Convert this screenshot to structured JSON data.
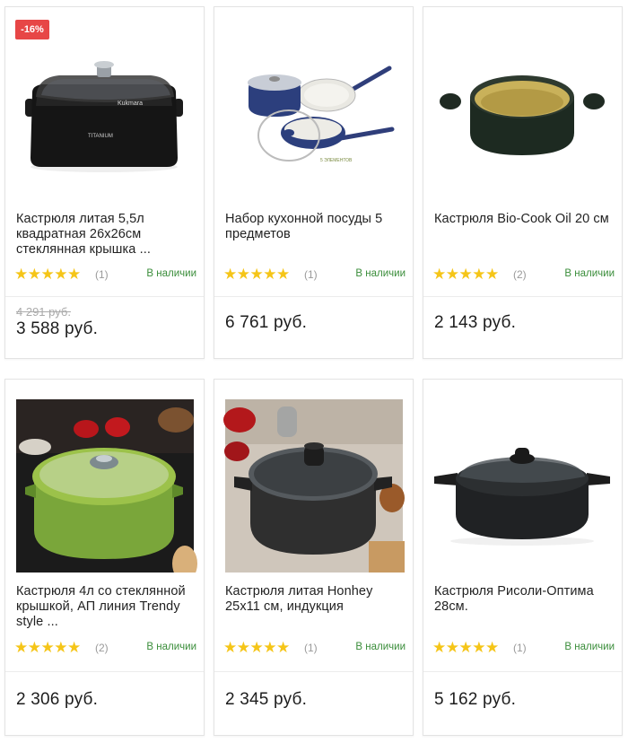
{
  "products": [
    {
      "title": "Кастрюля литая 5,5л квадратная 26х26см стеклянная крышка ...",
      "badge": "-16%",
      "stars": "★★★★★",
      "rating": 5,
      "reviews": "(1)",
      "availability": "В наличии",
      "old_price": "4 291 руб.",
      "price": "3 588 руб.",
      "image_icon": "square-pot-black-image"
    },
    {
      "title": "Набор кухонной посуды 5 предметов",
      "stars": "★★★★★",
      "rating": 5,
      "reviews": "(1)",
      "availability": "В наличии",
      "price": "6 761 руб.",
      "image_icon": "cookware-set-image"
    },
    {
      "title": "Кастрюля Bio-Cook Oil 20 см",
      "stars": "★★★★★",
      "rating": 5,
      "reviews": "(2)",
      "availability": "В наличии",
      "price": "2 143 руб.",
      "image_icon": "green-pot-image"
    },
    {
      "title": "Кастрюля 4л со стеклянной крышкой, АП линия Trendy style ...",
      "stars": "★★★★★",
      "rating": 5,
      "reviews": "(2)",
      "availability": "В наличии",
      "price": "2 306 руб.",
      "image_icon": "lime-pot-photo"
    },
    {
      "title": "Кастрюля литая Honhey 25х11 см, индукция",
      "stars": "★★★★★",
      "rating": 5,
      "reviews": "(1)",
      "availability": "В наличии",
      "price": "2 345 руб.",
      "image_icon": "granite-pot-photo"
    },
    {
      "title": "Кастрюля Рисоли-Оптима 28см.",
      "stars": "★★★★★",
      "rating": 5,
      "reviews": "(1)",
      "availability": "В наличии",
      "price": "5 162 руб.",
      "image_icon": "black-casserole-image"
    }
  ],
  "colors": {
    "badge": "#e74646",
    "stars": "#f5c518",
    "in_stock": "#3a8d3a",
    "old_price": "#aaaaaa"
  }
}
